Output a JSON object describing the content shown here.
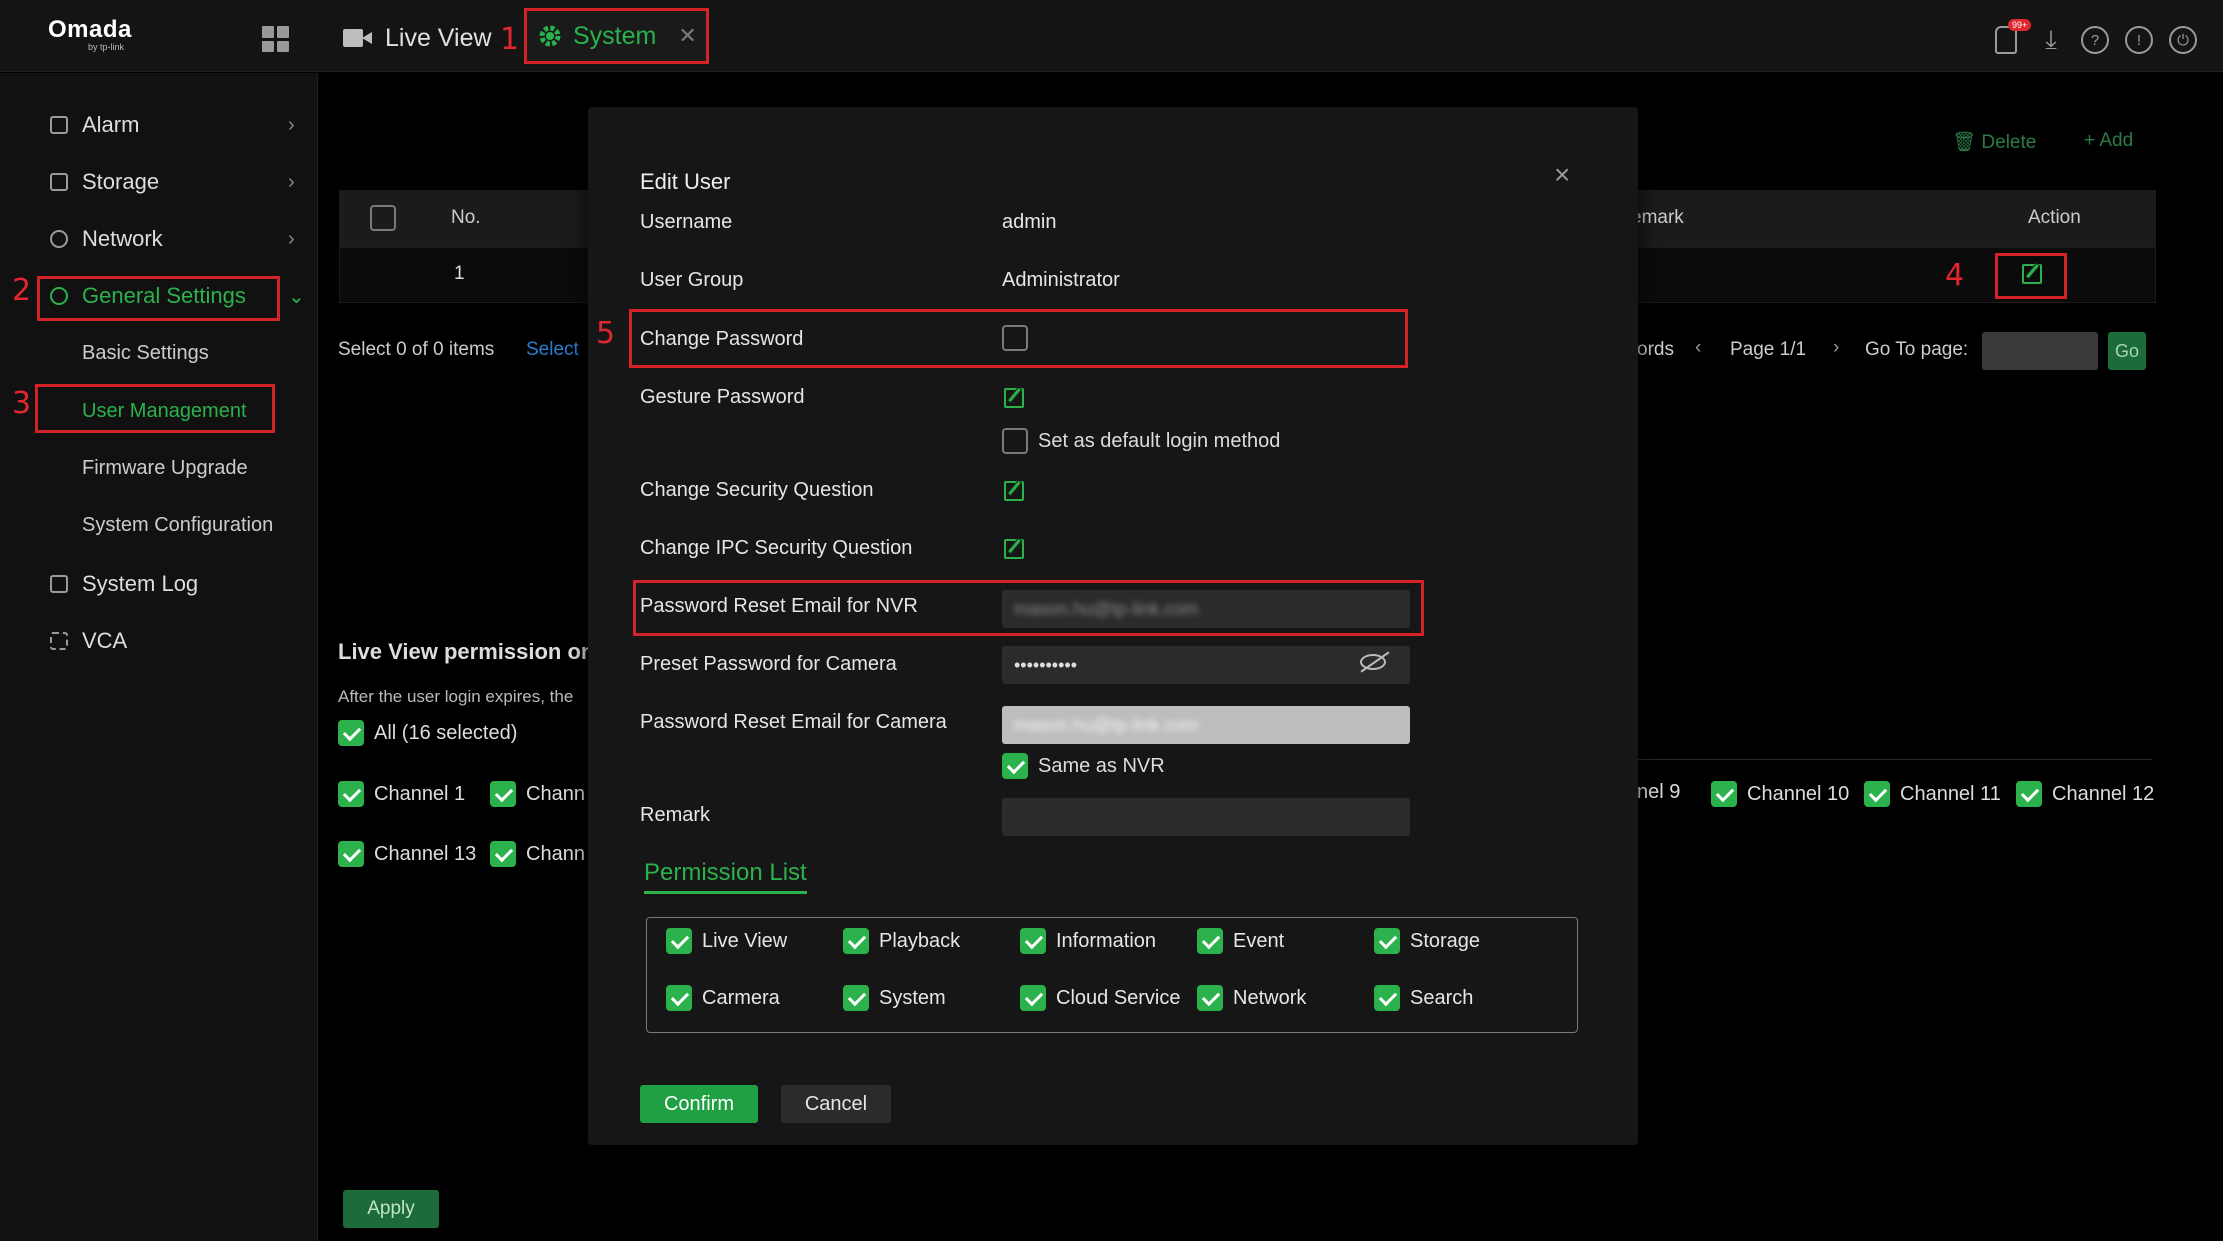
{
  "app": {
    "logo": "Omada",
    "logo_sub": "by tp-link"
  },
  "tabs": {
    "live_view": "Live View",
    "system": "System"
  },
  "notification_badge": "99+",
  "annotations": [
    "1",
    "2",
    "3",
    "4",
    "5"
  ],
  "sidebar": {
    "items": [
      {
        "label": "Alarm"
      },
      {
        "label": "Storage"
      },
      {
        "label": "Network"
      },
      {
        "label": "General Settings"
      },
      {
        "label": "System Log"
      },
      {
        "label": "VCA"
      }
    ],
    "sub_items": [
      "Basic Settings",
      "User Management",
      "Firmware Upgrade",
      "System Configuration"
    ]
  },
  "background": {
    "delete_label": "Delete",
    "add_label": "Add",
    "columns": {
      "no": "No.",
      "remark": "emark",
      "action": "Action"
    },
    "row_no": "1",
    "select_info": "Select 0 of 0 items",
    "select_link": "Select",
    "pager": {
      "records": "ords",
      "page": "Page 1/1",
      "goto": "Go To page:",
      "go": "Go"
    },
    "perm_title": "Live View permission on U",
    "perm_note": "After the user login expires, the",
    "all_selected": "All  (16 selected)",
    "channels_left": [
      "Channel 1",
      "Chann",
      "Channel 13",
      "Chann"
    ],
    "channels_right": [
      "nel 9",
      "Channel 10",
      "Channel 11",
      "Channel 12"
    ],
    "apply": "Apply"
  },
  "modal": {
    "title": "Edit User",
    "username_label": "Username",
    "username_value": "admin",
    "group_label": "User Group",
    "group_value": "Administrator",
    "change_password_label": "Change Password",
    "gesture_label": "Gesture Password",
    "default_login_label": "Set as default login method",
    "security_q_label": "Change Security Question",
    "ipc_security_q_label": "Change IPC Security Question",
    "nvr_email_label": "Password Reset Email for NVR",
    "nvr_email_value": "mason.hu@tp-link.com",
    "preset_pw_label": "Preset Password for Camera",
    "preset_pw_value": "••••••••••",
    "camera_email_label": "Password Reset Email for Camera",
    "camera_email_value": "mason.hu@tp-link.com",
    "same_as_nvr": "Same as NVR",
    "remark_label": "Remark",
    "remark_value": "",
    "permission_tab": "Permission List",
    "permissions": [
      "Live View",
      "Playback",
      "Information",
      "Event",
      "Storage",
      "Carmera",
      "System",
      "Cloud Service",
      "Network",
      "Search"
    ],
    "confirm": "Confirm",
    "cancel": "Cancel"
  },
  "colors": {
    "accent": "#2bb24c",
    "highlight": "#d42229",
    "background": "#000000"
  }
}
